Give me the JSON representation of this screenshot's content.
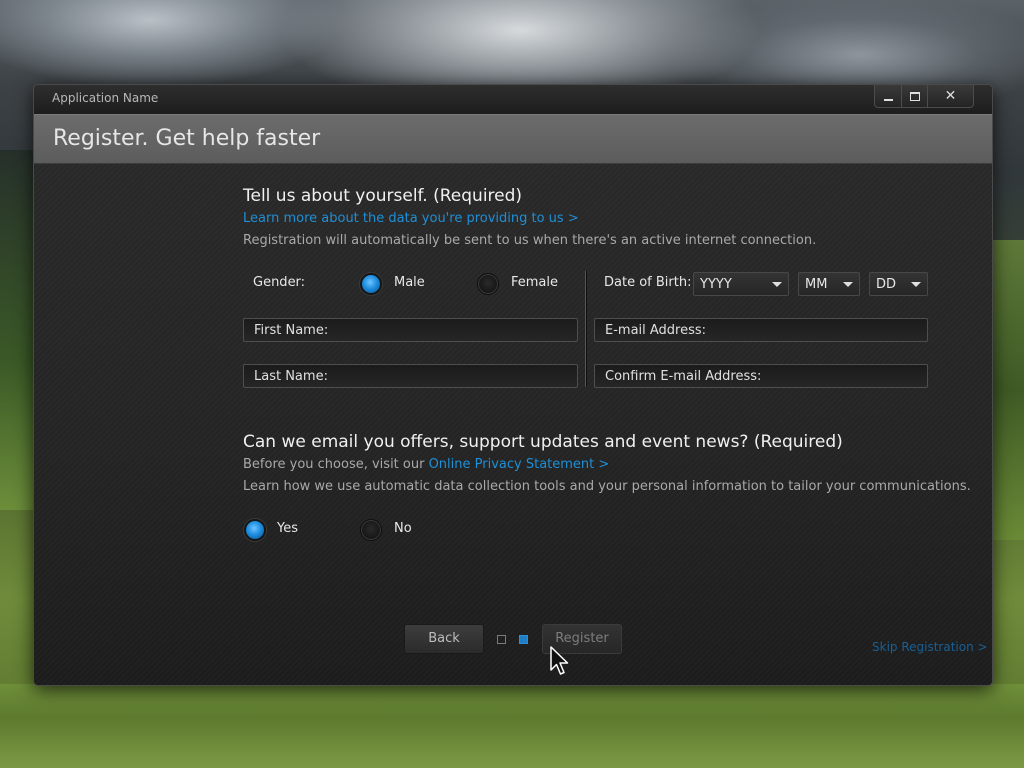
{
  "window": {
    "app_name": "Application Name",
    "controls": {
      "minimize_icon": "minimize-icon",
      "maximize_icon": "maximize-icon",
      "close_glyph": "✕"
    }
  },
  "header": {
    "title": "Register. Get help faster"
  },
  "about": {
    "title": "Tell us about yourself. (Required)",
    "learn_more_link": "Learn more about the data you're providing to us >",
    "note": "Registration will automatically be sent to us when there's an active internet connection."
  },
  "form": {
    "gender_label": "Gender:",
    "gender_options": [
      {
        "label": "Male",
        "checked": true
      },
      {
        "label": "Female",
        "checked": false
      }
    ],
    "dob_label": "Date of Birth:",
    "dob": {
      "year": "YYYY",
      "month": "MM",
      "day": "DD"
    },
    "first_name_placeholder": "First Name:",
    "last_name_placeholder": "Last Name:",
    "email_placeholder": "E-mail Address:",
    "confirm_email_placeholder": "Confirm E-mail Address:"
  },
  "offers": {
    "title": "Can we email you offers, support updates and event news? (Required)",
    "privacy_prefix": "Before you choose, visit our ",
    "privacy_link": "Online Privacy Statement >",
    "note": "Learn how we use automatic data collection tools and your personal information to tailor your communications.",
    "options": [
      {
        "label": "Yes",
        "checked": true
      },
      {
        "label": "No",
        "checked": false
      }
    ]
  },
  "footer": {
    "back_label": "Back",
    "register_label": "Register",
    "pager": {
      "current": 2,
      "total": 2
    },
    "skip_link": "Skip Registration >"
  },
  "colors": {
    "accent": "#1f8fd6",
    "header_band": "#656565",
    "window_bg": "#262626"
  }
}
